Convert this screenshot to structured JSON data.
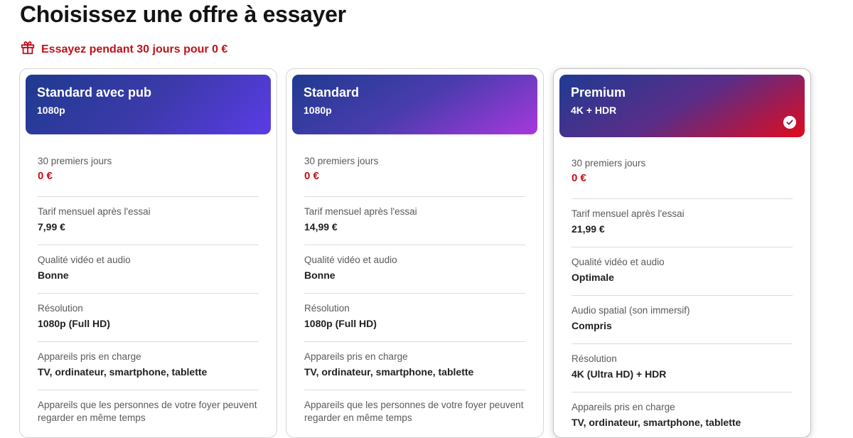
{
  "page": {
    "title": "Choisissez une offre à essayer",
    "promo_text": "Essayez pendant 30 jours pour 0 €",
    "accent_color": "#c11119"
  },
  "plans": [
    {
      "name": "Standard avec pub",
      "resolution_badge": "1080p",
      "selected": false,
      "rows": [
        {
          "label": "30 premiers jours",
          "value": "0 €"
        },
        {
          "label": "Tarif mensuel après l'essai",
          "value": "7,99 €"
        },
        {
          "label": "Qualité vidéo et audio",
          "value": "Bonne"
        },
        {
          "label": "Résolution",
          "value": "1080p (Full HD)"
        },
        {
          "label": "Appareils pris en charge",
          "value": "TV, ordinateur, smartphone, tablette"
        },
        {
          "label": "Appareils que les personnes de votre foyer peuvent regarder en même temps",
          "value": ""
        }
      ]
    },
    {
      "name": "Standard",
      "resolution_badge": "1080p",
      "selected": false,
      "rows": [
        {
          "label": "30 premiers jours",
          "value": "0 €"
        },
        {
          "label": "Tarif mensuel après l'essai",
          "value": "14,99 €"
        },
        {
          "label": "Qualité vidéo et audio",
          "value": "Bonne"
        },
        {
          "label": "Résolution",
          "value": "1080p (Full HD)"
        },
        {
          "label": "Appareils pris en charge",
          "value": "TV, ordinateur, smartphone, tablette"
        },
        {
          "label": "Appareils que les personnes de votre foyer peuvent regarder en même temps",
          "value": ""
        }
      ]
    },
    {
      "name": "Premium",
      "resolution_badge": "4K + HDR",
      "selected": true,
      "rows": [
        {
          "label": "30 premiers jours",
          "value": "0 €"
        },
        {
          "label": "Tarif mensuel après l'essai",
          "value": "21,99 €"
        },
        {
          "label": "Qualité vidéo et audio",
          "value": "Optimale"
        },
        {
          "label": "Audio spatial (son immersif)",
          "value": "Compris"
        },
        {
          "label": "Résolution",
          "value": "4K (Ultra HD) + HDR"
        },
        {
          "label": "Appareils pris en charge",
          "value": "TV, ordinateur, smartphone, tablette"
        }
      ]
    }
  ]
}
